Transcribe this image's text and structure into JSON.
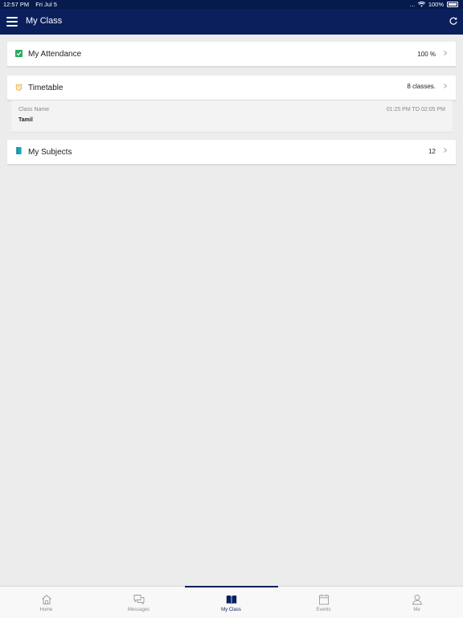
{
  "status": {
    "time": "12:57 PM",
    "date": "Fri Jul 5",
    "signal": "....",
    "battery": "100%"
  },
  "header": {
    "title": "My Class"
  },
  "attendance": {
    "title": "My Attendance",
    "value": "100 %"
  },
  "timetable": {
    "title": "Timetable",
    "value": "8 classes.",
    "detail": {
      "label": "Class Name",
      "name": "Tamil",
      "time": "01:25 PM TO 02:05 PM"
    }
  },
  "subjects": {
    "title": "My Subjects",
    "value": "12"
  },
  "tabs": [
    {
      "label": "Home",
      "icon": "home-icon"
    },
    {
      "label": "Messages",
      "icon": "messages-icon"
    },
    {
      "label": "My Class",
      "icon": "book-icon"
    },
    {
      "label": "Events",
      "icon": "calendar-icon"
    },
    {
      "label": "Me",
      "icon": "person-icon"
    }
  ],
  "colors": {
    "primary": "#0a1f5c",
    "attendance_icon": "#2eaa5e",
    "timetable_icon": "#f2a31b",
    "subjects_icon": "#15a6b8"
  }
}
